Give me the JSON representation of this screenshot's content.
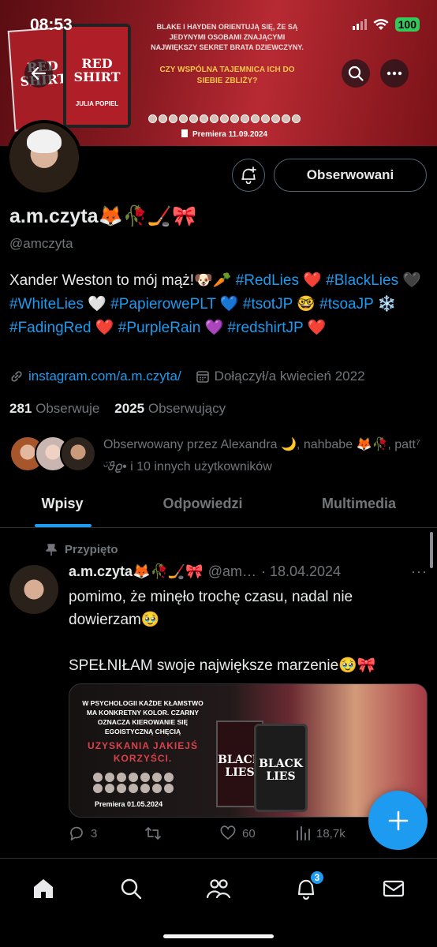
{
  "status": {
    "time": "08:53",
    "battery": "100"
  },
  "banner": {
    "book_title": "RED SHIRT",
    "book_author": "JULIA POPIEL",
    "blurb": "BLAKE I HAYDEN ORIENTUJĄ SIĘ, ŻE SĄ JEDYNYMI OSOBAMI ZNAJĄCYMI NAJWIĘKSZY SEKRET BRATA DZIEWCZYNY.",
    "blurb_highlight": "CZY WSPÓLNA TAJEMNICA ICH DO SIEBIE ZBLIŻY?",
    "premiere": "Premiera 11.09.2024"
  },
  "profile": {
    "display_name": "a.m.czyta🦊🥀🏒🎀",
    "handle": "@amczyta",
    "follow_button": "Obserwowani",
    "bio_parts": [
      {
        "text": "Xander Weston to mój mąż!🐶🥕 ",
        "tag": false
      },
      {
        "text": "#RedLies",
        "tag": true
      },
      {
        "text": " ❤️ ",
        "tag": false
      },
      {
        "text": "#BlackLies",
        "tag": true
      },
      {
        "text": " 🖤 ",
        "tag": false
      },
      {
        "text": "#WhiteLies",
        "tag": true
      },
      {
        "text": " 🤍 ",
        "tag": false
      },
      {
        "text": "#PapierowePLT",
        "tag": true
      },
      {
        "text": " 💙 ",
        "tag": false
      },
      {
        "text": "#tsotJP",
        "tag": true
      },
      {
        "text": " 🤓 ",
        "tag": false
      },
      {
        "text": "#tsoaJP",
        "tag": true
      },
      {
        "text": " ❄️ ",
        "tag": false
      },
      {
        "text": "#FadingRed",
        "tag": true
      },
      {
        "text": " ❤️ ",
        "tag": false
      },
      {
        "text": "#PurpleRain",
        "tag": true
      },
      {
        "text": " 💜 ",
        "tag": false
      },
      {
        "text": "#redshirtJP",
        "tag": true
      },
      {
        "text": " ❤️",
        "tag": false
      }
    ],
    "link": "instagram.com/a.m.czyta/",
    "joined": "Dołączył/a kwiecień 2022",
    "following_count": "281",
    "following_label": "Obserwuje",
    "followers_count": "2025",
    "followers_label": "Obserwujący",
    "followed_by": "Obserwowany przez Alexandra 🌙, nahbabe 🦊🥀, patt⁷ ᵕ̈𝜗𝜚• i 10 innych użytkowników"
  },
  "tabs": [
    "Wpisy",
    "Odpowiedzi",
    "Multimedia"
  ],
  "tweet": {
    "pinned_label": "Przypięto",
    "name": "a.m.czyta🦊🥀🏒🎀",
    "handle_short": "@am…",
    "date": "· 18.04.2024",
    "text": "pomimo, że minęło trochę czasu, nadal nie dowierzam🥹\n\nSPEŁNIŁAM swoje największe marzenie🥹🎀",
    "media": {
      "caption": "W PSYCHOLOGII KAŻDE KŁAMSTWO MA KONKRETNY KOLOR. CZARNY OZNACZA KIEROWANIE SIĘ EGOISTYCZNĄ CHĘCIĄ",
      "caption_red": "UZYSKANIA JAKIEJŚ KORZYŚCI.",
      "premiere": "Premiera 01.05.2024",
      "book_title": "BLACK LIES"
    },
    "replies": "3",
    "retweets": "",
    "likes": "60",
    "views": "18,7k"
  },
  "nav": {
    "notifications_badge": "3"
  },
  "colors": {
    "accent": "#1d9bf0",
    "muted": "#71767b",
    "background": "#000000"
  }
}
